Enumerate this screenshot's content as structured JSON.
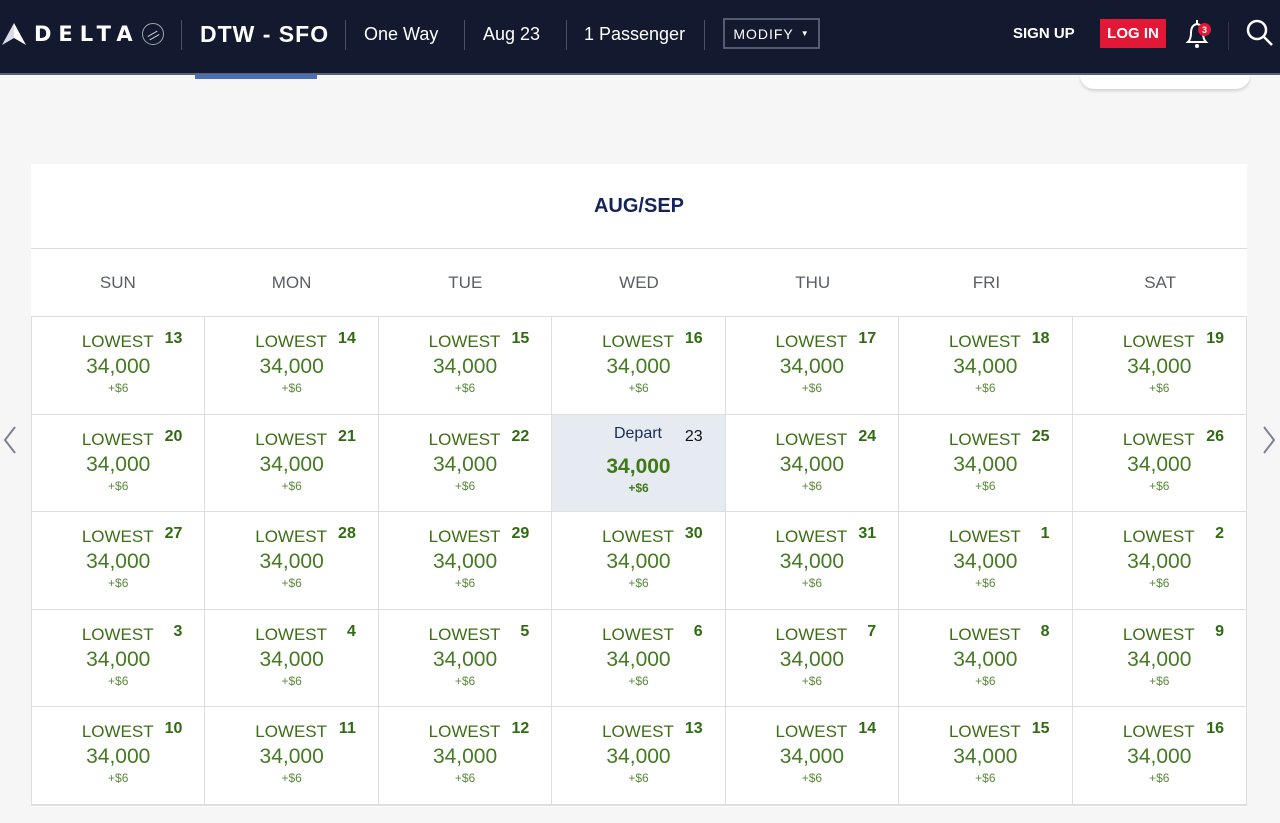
{
  "header": {
    "brand": "DELTA",
    "route": "DTW - SFO",
    "trip_type": "One Way",
    "date": "Aug 23",
    "passengers": "1 Passenger",
    "modify_label": "MODIFY",
    "signup_label": "SIGN UP",
    "login_label": "LOG IN",
    "notification_count": "3",
    "icons": {
      "logo": "delta-widget-icon",
      "bell": "bell-icon",
      "search": "search-icon",
      "caret": "caret-down-icon"
    }
  },
  "calendar": {
    "title": "AUG/SEP",
    "weekdays": [
      "SUN",
      "MON",
      "TUE",
      "WED",
      "THU",
      "FRI",
      "SAT"
    ],
    "prev_label": "previous-week",
    "next_label": "next-week",
    "cells": [
      {
        "day": "13",
        "label": "LOWEST",
        "miles": "34,000",
        "tax": "+$6"
      },
      {
        "day": "14",
        "label": "LOWEST",
        "miles": "34,000",
        "tax": "+$6"
      },
      {
        "day": "15",
        "label": "LOWEST",
        "miles": "34,000",
        "tax": "+$6"
      },
      {
        "day": "16",
        "label": "LOWEST",
        "miles": "34,000",
        "tax": "+$6"
      },
      {
        "day": "17",
        "label": "LOWEST",
        "miles": "34,000",
        "tax": "+$6"
      },
      {
        "day": "18",
        "label": "LOWEST",
        "miles": "34,000",
        "tax": "+$6"
      },
      {
        "day": "19",
        "label": "LOWEST",
        "miles": "34,000",
        "tax": "+$6"
      },
      {
        "day": "20",
        "label": "LOWEST",
        "miles": "34,000",
        "tax": "+$6"
      },
      {
        "day": "21",
        "label": "LOWEST",
        "miles": "34,000",
        "tax": "+$6"
      },
      {
        "day": "22",
        "label": "LOWEST",
        "miles": "34,000",
        "tax": "+$6"
      },
      {
        "day": "23",
        "label": "Depart",
        "miles": "34,000",
        "tax": "+$6",
        "selected": true
      },
      {
        "day": "24",
        "label": "LOWEST",
        "miles": "34,000",
        "tax": "+$6"
      },
      {
        "day": "25",
        "label": "LOWEST",
        "miles": "34,000",
        "tax": "+$6"
      },
      {
        "day": "26",
        "label": "LOWEST",
        "miles": "34,000",
        "tax": "+$6"
      },
      {
        "day": "27",
        "label": "LOWEST",
        "miles": "34,000",
        "tax": "+$6"
      },
      {
        "day": "28",
        "label": "LOWEST",
        "miles": "34,000",
        "tax": "+$6"
      },
      {
        "day": "29",
        "label": "LOWEST",
        "miles": "34,000",
        "tax": "+$6"
      },
      {
        "day": "30",
        "label": "LOWEST",
        "miles": "34,000",
        "tax": "+$6"
      },
      {
        "day": "31",
        "label": "LOWEST",
        "miles": "34,000",
        "tax": "+$6"
      },
      {
        "day": "1",
        "label": "LOWEST",
        "miles": "34,000",
        "tax": "+$6"
      },
      {
        "day": "2",
        "label": "LOWEST",
        "miles": "34,000",
        "tax": "+$6"
      },
      {
        "day": "3",
        "label": "LOWEST",
        "miles": "34,000",
        "tax": "+$6"
      },
      {
        "day": "4",
        "label": "LOWEST",
        "miles": "34,000",
        "tax": "+$6"
      },
      {
        "day": "5",
        "label": "LOWEST",
        "miles": "34,000",
        "tax": "+$6"
      },
      {
        "day": "6",
        "label": "LOWEST",
        "miles": "34,000",
        "tax": "+$6"
      },
      {
        "day": "7",
        "label": "LOWEST",
        "miles": "34,000",
        "tax": "+$6"
      },
      {
        "day": "8",
        "label": "LOWEST",
        "miles": "34,000",
        "tax": "+$6"
      },
      {
        "day": "9",
        "label": "LOWEST",
        "miles": "34,000",
        "tax": "+$6"
      },
      {
        "day": "10",
        "label": "LOWEST",
        "miles": "34,000",
        "tax": "+$6"
      },
      {
        "day": "11",
        "label": "LOWEST",
        "miles": "34,000",
        "tax": "+$6"
      },
      {
        "day": "12",
        "label": "LOWEST",
        "miles": "34,000",
        "tax": "+$6"
      },
      {
        "day": "13",
        "label": "LOWEST",
        "miles": "34,000",
        "tax": "+$6"
      },
      {
        "day": "14",
        "label": "LOWEST",
        "miles": "34,000",
        "tax": "+$6"
      },
      {
        "day": "15",
        "label": "LOWEST",
        "miles": "34,000",
        "tax": "+$6"
      },
      {
        "day": "16",
        "label": "LOWEST",
        "miles": "34,000",
        "tax": "+$6"
      }
    ]
  },
  "colors": {
    "nav_bg": "#131a30",
    "login_red": "#e31837",
    "price_green": "#447a22",
    "title_navy": "#14235a",
    "selected_bg": "#e6ebf2",
    "tab_indicator": "#4a6fb5"
  }
}
